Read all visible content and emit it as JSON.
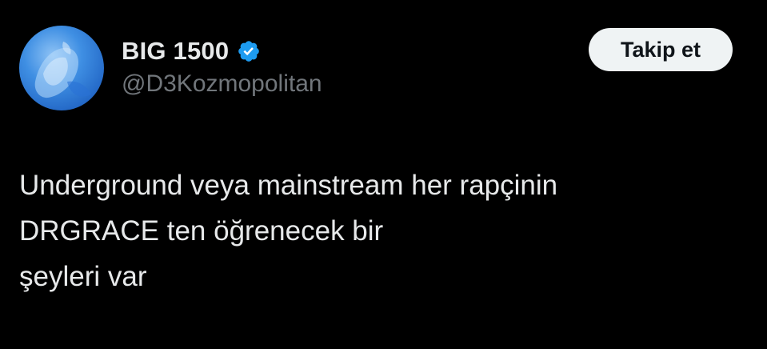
{
  "user": {
    "display_name": "BIG 1500",
    "handle": "@D3Kozmopolitan",
    "verified_icon": "verified-badge-icon",
    "avatar_icon": "avatar"
  },
  "actions": {
    "follow_label": "Takip et"
  },
  "tweet": {
    "text": "Underground veya mainstream her rapçinin\nDRGRACE ten öğrenecek bir\nşeyleri var"
  },
  "colors": {
    "background": "#000000",
    "primary_text": "#e7e9ea",
    "secondary_text": "#71767b",
    "verified_blue": "#1d9bf0",
    "button_bg": "#eff3f4",
    "button_text": "#0f1419"
  }
}
